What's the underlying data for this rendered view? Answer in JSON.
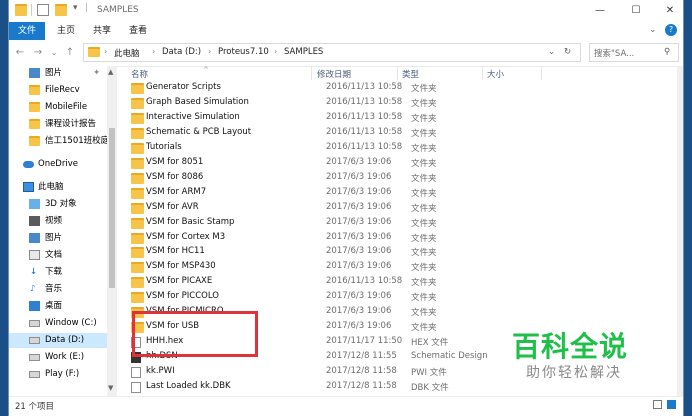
{
  "window": {
    "title": "SAMPLES"
  },
  "ribbon": {
    "tabs": [
      {
        "label": "文件",
        "active": true
      },
      {
        "label": "主页",
        "active": false
      },
      {
        "label": "共享",
        "active": false
      },
      {
        "label": "查看",
        "active": false
      }
    ]
  },
  "address": {
    "crumbs": [
      "此电脑",
      "Data (D:)",
      "Proteus7.10",
      "SAMPLES"
    ],
    "search_placeholder": "搜索\"SA..."
  },
  "sidebar": {
    "items": [
      {
        "label": "图片",
        "icon": "picture-icon",
        "top": 0
      },
      {
        "label": "FileRecv",
        "icon": "folder-icon"
      },
      {
        "label": "MobileFile",
        "icon": "folder-icon"
      },
      {
        "label": "课程设计报告",
        "icon": "folder-icon"
      },
      {
        "label": "信工1501班校庭",
        "icon": "folder-icon"
      },
      {
        "label": "OneDrive",
        "icon": "cloud-icon"
      },
      {
        "label": "此电脑",
        "icon": "computer-icon"
      },
      {
        "label": "3D 对象",
        "icon": "cube-icon"
      },
      {
        "label": "视频",
        "icon": "video-icon"
      },
      {
        "label": "图片",
        "icon": "picture-icon"
      },
      {
        "label": "文档",
        "icon": "document-icon"
      },
      {
        "label": "下载",
        "icon": "download-icon"
      },
      {
        "label": "音乐",
        "icon": "music-icon"
      },
      {
        "label": "桌面",
        "icon": "desktop-icon"
      },
      {
        "label": "Window (C:)",
        "icon": "drive-icon"
      },
      {
        "label": "Data (D:)",
        "icon": "drive-icon",
        "selected": true
      },
      {
        "label": "Work (E:)",
        "icon": "drive-icon"
      },
      {
        "label": "Play (F:)",
        "icon": "drive-icon"
      }
    ]
  },
  "columns": {
    "name": "名称",
    "date": "修改日期",
    "type": "类型",
    "size": "大小"
  },
  "files": [
    {
      "name": "Generator Scripts",
      "date": "2016/11/13 10:58",
      "type": "文件夹",
      "kind": "folder"
    },
    {
      "name": "Graph Based Simulation",
      "date": "2016/11/13 10:58",
      "type": "文件夹",
      "kind": "folder"
    },
    {
      "name": "Interactive Simulation",
      "date": "2016/11/13 10:58",
      "type": "文件夹",
      "kind": "folder"
    },
    {
      "name": "Schematic & PCB Layout",
      "date": "2016/11/13 10:58",
      "type": "文件夹",
      "kind": "folder"
    },
    {
      "name": "Tutorials",
      "date": "2016/11/13 10:58",
      "type": "文件夹",
      "kind": "folder"
    },
    {
      "name": "VSM for 8051",
      "date": "2017/6/3 19:06",
      "type": "文件夹",
      "kind": "folder"
    },
    {
      "name": "VSM for 8086",
      "date": "2017/6/3 19:06",
      "type": "文件夹",
      "kind": "folder"
    },
    {
      "name": "VSM for ARM7",
      "date": "2017/6/3 19:06",
      "type": "文件夹",
      "kind": "folder"
    },
    {
      "name": "VSM for AVR",
      "date": "2017/6/3 19:06",
      "type": "文件夹",
      "kind": "folder"
    },
    {
      "name": "VSM for Basic Stamp",
      "date": "2017/6/3 19:06",
      "type": "文件夹",
      "kind": "folder"
    },
    {
      "name": "VSM for Cortex M3",
      "date": "2017/6/3 19:06",
      "type": "文件夹",
      "kind": "folder"
    },
    {
      "name": "VSM for HC11",
      "date": "2017/6/3 19:06",
      "type": "文件夹",
      "kind": "folder"
    },
    {
      "name": "VSM for MSP430",
      "date": "2017/6/3 19:06",
      "type": "文件夹",
      "kind": "folder"
    },
    {
      "name": "VSM for PICAXE",
      "date": "2016/11/13 10:58",
      "type": "文件夹",
      "kind": "folder"
    },
    {
      "name": "VSM for PICCOLO",
      "date": "2017/6/3 19:06",
      "type": "文件夹",
      "kind": "folder"
    },
    {
      "name": "VSM for PICMICRO",
      "date": "2017/6/3 19:06",
      "type": "文件夹",
      "kind": "folder"
    },
    {
      "name": "VSM for USB",
      "date": "2017/6/3 19:06",
      "type": "文件夹",
      "kind": "folder"
    },
    {
      "name": "HHH.hex",
      "date": "2017/11/17 11:50",
      "type": "HEX 文件",
      "kind": "file"
    },
    {
      "name": "hh.DSN",
      "date": "2017/12/8 11:55",
      "type": "Schematic Design",
      "kind": "dsn"
    },
    {
      "name": "kk.PWI",
      "date": "2017/12/8 11:58",
      "type": "PWI 文件",
      "kind": "file"
    },
    {
      "name": "Last Loaded kk.DBK",
      "date": "2017/12/8 11:58",
      "type": "DBK 文件",
      "kind": "file"
    }
  ],
  "status": {
    "count": "21 个项目"
  },
  "watermark": {
    "line1": "百科全说",
    "line2": "助你轻松解决"
  },
  "colors": {
    "accent": "#1979ca",
    "folder": "#f5c449",
    "highlight": "#e0323a",
    "watermark": "#1fbf49"
  }
}
